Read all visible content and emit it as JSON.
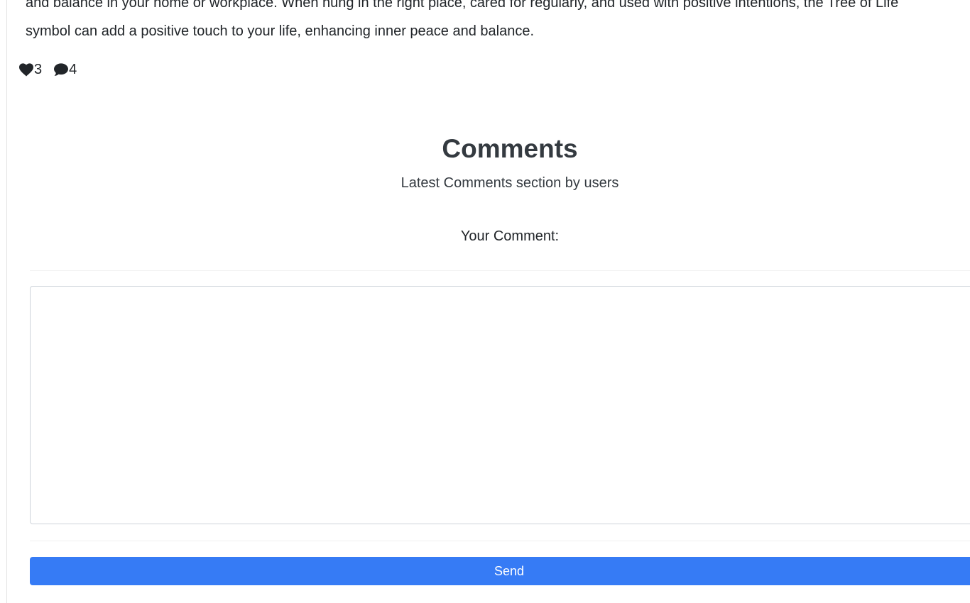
{
  "article": {
    "line1": "and balance in your home or workplace. When hung in the right place, cared for regularly, and used with positive intentions, the Tree of Life",
    "line2": "symbol can add a positive touch to your life, enhancing inner peace and balance."
  },
  "reactions": {
    "likes": {
      "icon": "heart-icon",
      "count": "3"
    },
    "comments": {
      "icon": "comment-icon",
      "count": "4"
    }
  },
  "comments_section": {
    "title": "Comments",
    "subtitle": "Latest Comments section by users",
    "form_label": "Your Comment:",
    "textarea_value": "",
    "send_label": "Send"
  },
  "colors": {
    "primary_button": "#367bf5",
    "text": "#212529",
    "heading": "#343a40"
  }
}
